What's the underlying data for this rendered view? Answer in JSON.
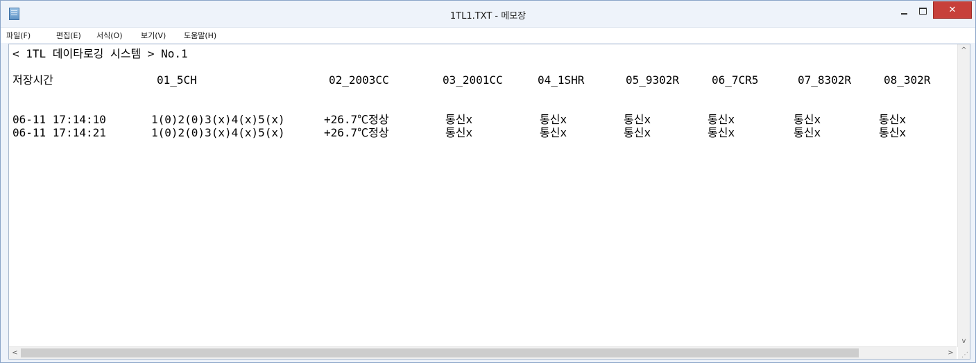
{
  "window": {
    "title": "1TL1.TXT - 메모장",
    "icon": "notepad-icon",
    "controls": {
      "minimize": "minimize-icon",
      "maximize": "maximize-icon",
      "close": "✕"
    }
  },
  "menu": {
    "items": [
      {
        "label": "파일(F)"
      },
      {
        "label": "편집(E)"
      },
      {
        "label": "서식(O)"
      },
      {
        "label": "보기(V)"
      },
      {
        "label": "도움말(H)"
      }
    ]
  },
  "document": {
    "title_line": "< 1TL 데이타로깅 시스템 > No.1",
    "headers": [
      "저장시간",
      "01_5CH",
      "02_2003CC",
      "03_2001CC",
      "04_1SHR",
      "05_9302R",
      "06_7CR5",
      "07_8302R",
      "08_302R"
    ],
    "rows": [
      [
        "06-11 17:14:10",
        "1(0)2(0)3(x)4(x)5(x)",
        "+26.7℃정상",
        "통신x",
        "통신x",
        "통신x",
        "통신x",
        "통신x",
        "통신x"
      ],
      [
        "06-11 17:14:21",
        "1(0)2(0)3(x)4(x)5(x)",
        "+26.7℃정상",
        "통신x",
        "통신x",
        "통신x",
        "통신x",
        "통신x",
        "통신x"
      ]
    ]
  },
  "scrollbars": {
    "up_arrow": "^",
    "down_arrow": "v",
    "left_arrow": "<",
    "right_arrow": ">"
  }
}
